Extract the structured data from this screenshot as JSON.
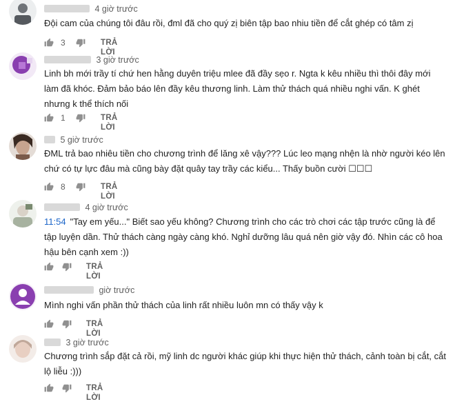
{
  "comments": [
    {
      "time": "4 giờ trước",
      "text": "Đội cam của chúng tôi đâu rồi, đml đã cho quý zị biên tập bao nhiu tiền để cắt ghép có tâm zị",
      "like_count": "3",
      "reply_label": "TRẢ LỜI"
    },
    {
      "time": "3 giờ trước",
      "text": "Linh bh mới trầy tí chứ hen hằng duyên triệu mlee đã đầy sẹo r. Ngta k kêu nhiều thì thôi đây mới làm đã khóc. Đảm bảo báo lên đầy kêu thương linh. Làm thử thách quá nhiều nghi vấn. K ghét nhưng k thể thích nối",
      "like_count": "1",
      "reply_label": "TRẢ LỜI"
    },
    {
      "time": "5 giờ trước",
      "text": "ĐML trả bao nhiêu tiền cho chương trình để lăng xê vậy??? Lúc leo mạng nhện là nhờ người kéo lên chứ có tự lực đâu mà cũng bày đặt quây tay trầy các kiểu... Thấy buồn cười ☐☐☐",
      "like_count": "8",
      "reply_label": "TRẢ LỜI"
    },
    {
      "time": "4 giờ trước",
      "timestamp_link": "11:54",
      "text": "\"Tay em yếu...\" Biết sao yếu không? Chương trình cho các trò chơi các tập trước cũng là để tập luyện dần. Thử thách càng ngày càng khó. Nghỉ dưỡng lâu quá nên giờ vậy đó. Nhìn các cô hoa hậu bên cạnh xem :))",
      "reply_label": "TRẢ LỜI"
    },
    {
      "time": "giờ trước",
      "text": "Mình nghi vấn phần thử thách của linh rất nhiều luôn mn có thấy vậy k",
      "reply_label": "TRẢ LỜI"
    },
    {
      "time": "3 giờ trước",
      "text": "Chương trình sắp đặt cả rồi, mỹ linh dc người khác giúp khi thực hiện thử thách, cảnh toàn bị cắt, cắt lộ liễu :)))",
      "reply_label": "TRẢ LỜI"
    }
  ],
  "icons": {
    "like": "thumbs-up-icon",
    "dislike": "thumbs-down-icon"
  },
  "colors": {
    "text": "#222222",
    "meta": "#606060",
    "timestamp_link": "#1a64c8",
    "name_blur": "#d9d9d9"
  }
}
